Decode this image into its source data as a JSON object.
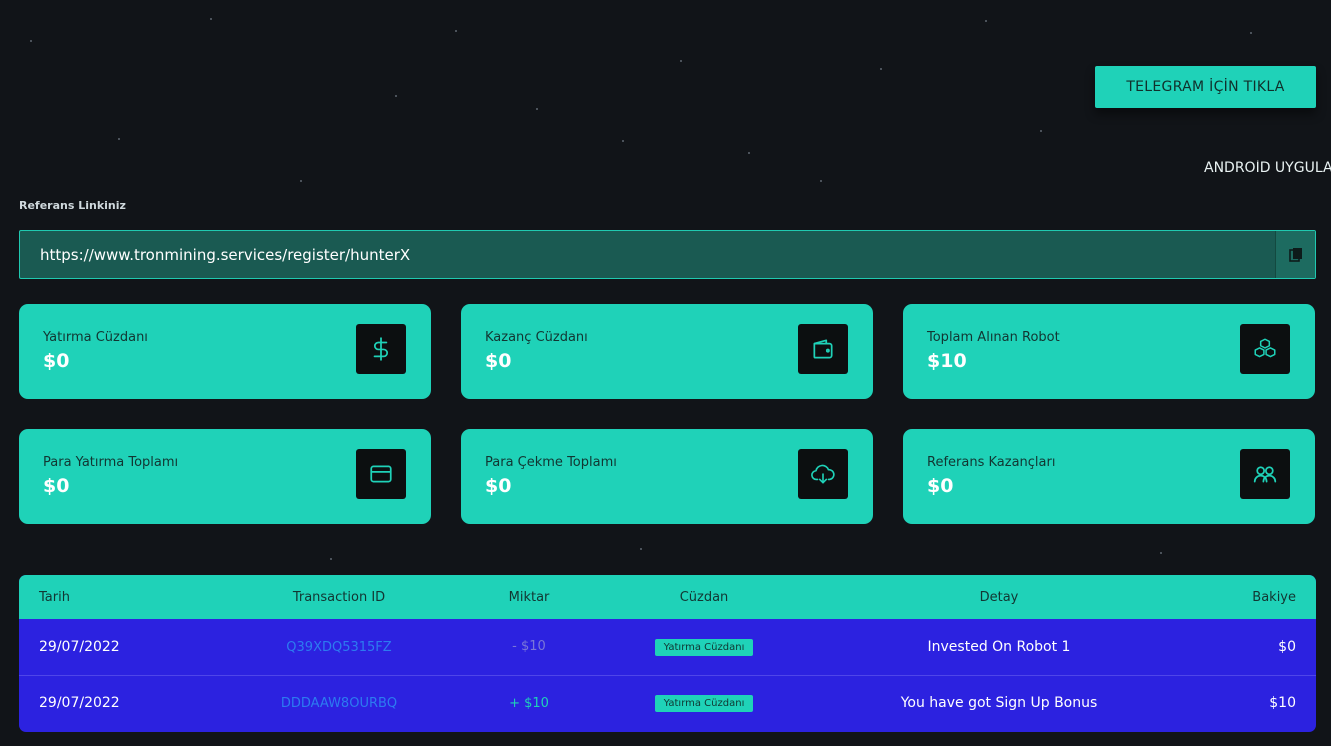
{
  "header": {
    "telegram_button": "TELEGRAM İÇİN TIKLA",
    "android_text": "ANDROİD UYGULAMASI"
  },
  "referral": {
    "label": "Referans Linkiniz",
    "link": "https://www.tronmining.services/register/hunterX"
  },
  "cards": [
    {
      "title": "Yatırma Cüzdanı",
      "value": "$0",
      "icon": "dollar-icon"
    },
    {
      "title": "Kazanç Cüzdanı",
      "value": "$0",
      "icon": "wallet-icon"
    },
    {
      "title": "Toplam Alınan Robot",
      "value": "$10",
      "icon": "cubes-icon"
    },
    {
      "title": "Para Yatırma Toplamı",
      "value": "$0",
      "icon": "credit-card-icon"
    },
    {
      "title": "Para Çekme Toplamı",
      "value": "$0",
      "icon": "cloud-download-icon"
    },
    {
      "title": "Referans Kazançları",
      "value": "$0",
      "icon": "users-icon"
    }
  ],
  "table": {
    "headers": [
      "Tarih",
      "Transaction ID",
      "Miktar",
      "Cüzdan",
      "Detay",
      "Bakiye"
    ],
    "rows": [
      {
        "date": "29/07/2022",
        "tx_id": "Q39XDQ5315FZ",
        "amount": "- $10",
        "wallet": "Yatırma Cüzdanı",
        "detail": "Invested On Robot 1",
        "balance": "$0"
      },
      {
        "date": "29/07/2022",
        "tx_id": "DDDAAW8OURBQ",
        "amount": "+ $10",
        "wallet": "Yatırma Cüzdanı",
        "detail": "You have got Sign Up Bonus",
        "balance": "$10"
      }
    ]
  },
  "colors": {
    "accent": "#1fd2b8",
    "background": "#111418",
    "table_body": "#2c22e0",
    "link": "#2d7bf0"
  }
}
